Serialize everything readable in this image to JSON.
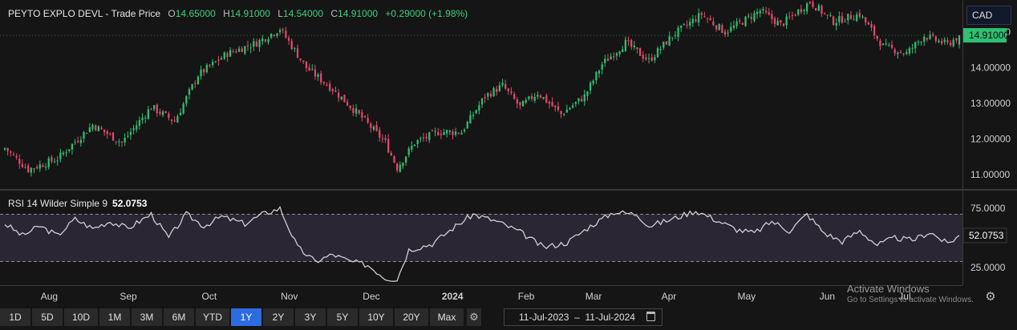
{
  "legend": {
    "title": "PEYTO EXPLO DEVL - Trade Price",
    "o_label": "O",
    "o": "14.65000",
    "h_label": "H",
    "h": "14.91000",
    "l_label": "L",
    "l": "14.54000",
    "c_label": "C",
    "c": "14.91000",
    "change": "+0.29000 (+1.98%)"
  },
  "rsi_legend": {
    "label": "RSI 14 Wilder Simple 9",
    "value": "52.0753"
  },
  "currency": {
    "label": "CAD"
  },
  "last_price_label": "14.91000",
  "last_rsi_label": "52.0753",
  "colors": {
    "up": "#2fbf71",
    "down": "#e3486a",
    "background": "#151515",
    "rsi_band": "#2a2634",
    "rsi_line": "#cfcfcf",
    "price_tag": "#2fbf71",
    "accent": "#2c6be0"
  },
  "chart_data": [
    {
      "type": "candlestick",
      "title": "PEYTO EXPLO DEVL - Trade Price",
      "ylim": [
        10.6,
        15.9
      ],
      "yticks": [
        "11.00000",
        "12.00000",
        "13.00000",
        "14.00000",
        "15.00000"
      ],
      "ytick_values": [
        11,
        12,
        13,
        14,
        15
      ],
      "last": {
        "open": 14.65,
        "high": 14.91,
        "low": 14.54,
        "close": 14.91
      },
      "anchors": [
        [
          0,
          11.75
        ],
        [
          8,
          11.15
        ],
        [
          18,
          11.45
        ],
        [
          30,
          12.4
        ],
        [
          40,
          11.9
        ],
        [
          50,
          12.9
        ],
        [
          58,
          12.5
        ],
        [
          66,
          13.8
        ],
        [
          76,
          14.4
        ],
        [
          86,
          14.7
        ],
        [
          94,
          15.1
        ],
        [
          103,
          14.0
        ],
        [
          112,
          13.4
        ],
        [
          122,
          12.6
        ],
        [
          130,
          11.9
        ],
        [
          134,
          11.2
        ],
        [
          140,
          11.9
        ],
        [
          148,
          12.2
        ],
        [
          156,
          12.2
        ],
        [
          164,
          13.2
        ],
        [
          170,
          13.5
        ],
        [
          176,
          12.9
        ],
        [
          182,
          13.3
        ],
        [
          190,
          12.7
        ],
        [
          198,
          13.2
        ],
        [
          204,
          14.1
        ],
        [
          212,
          14.7
        ],
        [
          220,
          14.2
        ],
        [
          228,
          14.9
        ],
        [
          238,
          15.5
        ],
        [
          246,
          15.0
        ],
        [
          258,
          15.6
        ],
        [
          265,
          15.2
        ],
        [
          275,
          15.85
        ],
        [
          283,
          15.3
        ],
        [
          292,
          15.5
        ],
        [
          300,
          14.6
        ],
        [
          308,
          14.4
        ],
        [
          314,
          14.9
        ],
        [
          322,
          14.65
        ],
        [
          326,
          14.91
        ]
      ]
    },
    {
      "type": "line",
      "title": "RSI 14 Wilder Simple 9",
      "ylim": [
        10,
        90
      ],
      "yticks": [
        "25.0000",
        "75.0000"
      ],
      "ytick_values": [
        25,
        75
      ],
      "bands": [
        30,
        70
      ],
      "last_value": 52.0753,
      "anchors": [
        [
          0,
          62
        ],
        [
          6,
          52
        ],
        [
          12,
          60
        ],
        [
          18,
          52
        ],
        [
          24,
          66
        ],
        [
          30,
          58
        ],
        [
          36,
          64
        ],
        [
          42,
          58
        ],
        [
          50,
          70
        ],
        [
          56,
          50
        ],
        [
          62,
          70
        ],
        [
          68,
          60
        ],
        [
          74,
          68
        ],
        [
          82,
          62
        ],
        [
          88,
          70
        ],
        [
          94,
          75
        ],
        [
          100,
          42
        ],
        [
          106,
          30
        ],
        [
          112,
          36
        ],
        [
          118,
          30
        ],
        [
          124,
          27
        ],
        [
          130,
          16
        ],
        [
          134,
          15
        ],
        [
          138,
          40
        ],
        [
          146,
          45
        ],
        [
          154,
          60
        ],
        [
          160,
          70
        ],
        [
          168,
          64
        ],
        [
          176,
          55
        ],
        [
          184,
          42
        ],
        [
          192,
          46
        ],
        [
          200,
          60
        ],
        [
          208,
          72
        ],
        [
          216,
          70
        ],
        [
          220,
          60
        ],
        [
          228,
          66
        ],
        [
          236,
          73
        ],
        [
          244,
          64
        ],
        [
          250,
          57
        ],
        [
          256,
          54
        ],
        [
          262,
          64
        ],
        [
          268,
          56
        ],
        [
          274,
          70
        ],
        [
          280,
          54
        ],
        [
          286,
          47
        ],
        [
          292,
          56
        ],
        [
          298,
          44
        ],
        [
          304,
          50
        ],
        [
          310,
          48
        ],
        [
          316,
          55
        ],
        [
          322,
          45
        ],
        [
          326,
          52.0753
        ]
      ]
    }
  ],
  "x_axis": {
    "labels": [
      "Aug",
      "Sep",
      "Oct",
      "Nov",
      "Dec",
      "2024",
      "Feb",
      "Mar",
      "Apr",
      "May",
      "Jun",
      "Jul"
    ]
  },
  "ranges": [
    "1D",
    "5D",
    "10D",
    "1M",
    "3M",
    "6M",
    "YTD",
    "1Y",
    "2Y",
    "3Y",
    "5Y",
    "10Y",
    "20Y",
    "Max"
  ],
  "active_range": "1Y",
  "date_range": {
    "text": "11-Jul-2023  –  11-Jul-2024"
  },
  "watermark": {
    "line1": "Activate Windows",
    "line2": "Go to Settings to activate Windows."
  }
}
